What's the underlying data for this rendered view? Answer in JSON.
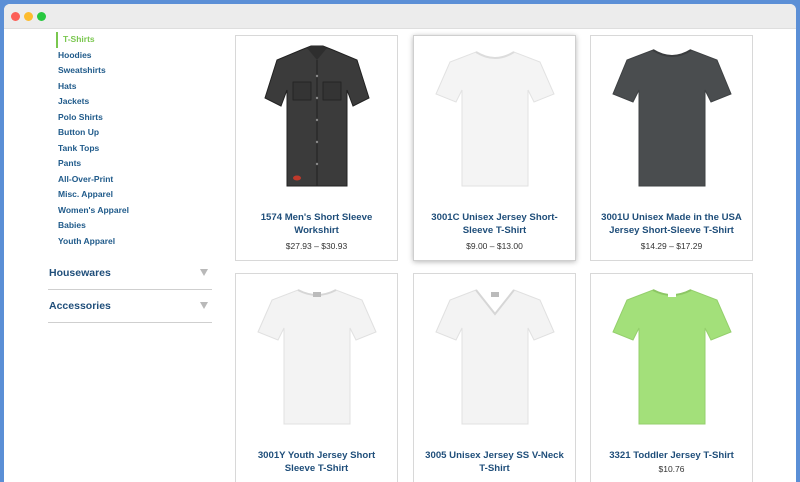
{
  "categories": [
    {
      "label": "T-Shirts",
      "active": true
    },
    {
      "label": "Hoodies"
    },
    {
      "label": "Sweatshirts"
    },
    {
      "label": "Hats"
    },
    {
      "label": "Jackets"
    },
    {
      "label": "Polo Shirts"
    },
    {
      "label": "Button Up"
    },
    {
      "label": "Tank Tops"
    },
    {
      "label": "Pants"
    },
    {
      "label": "All-Over-Print"
    },
    {
      "label": "Misc. Apparel"
    },
    {
      "label": "Women's Apparel"
    },
    {
      "label": "Babies"
    },
    {
      "label": "Youth Apparel"
    }
  ],
  "sections": [
    {
      "label": "Housewares"
    },
    {
      "label": "Accessories"
    }
  ],
  "products": [
    {
      "title": "1574 Men's Short Sleeve Workshirt",
      "price": "$27.93 – $30.93",
      "color": "#3b3b3b",
      "icon": "workshirt-icon"
    },
    {
      "title": "3001C Unisex Jersey Short-Sleeve T-Shirt",
      "price": "$9.00 – $13.00",
      "color": "#f4f4f4",
      "icon": "tshirt-icon"
    },
    {
      "title": "3001U Unisex Made in the USA Jersey Short-Sleeve T-Shirt",
      "price": "$14.29 – $17.29",
      "color": "#4a4d4f",
      "icon": "tshirt-icon"
    },
    {
      "title": "3001Y Youth Jersey Short Sleeve T-Shirt",
      "price": "",
      "color": "#f3f3f3",
      "icon": "tshirt-icon"
    },
    {
      "title": "3005 Unisex Jersey SS V-Neck T-Shirt",
      "price": "",
      "color": "#f3f3f3",
      "icon": "vneck-tshirt-icon"
    },
    {
      "title": "3321 Toddler Jersey T-Shirt",
      "price": "$10.76",
      "color": "#a3e07a",
      "icon": "tshirt-icon"
    }
  ]
}
